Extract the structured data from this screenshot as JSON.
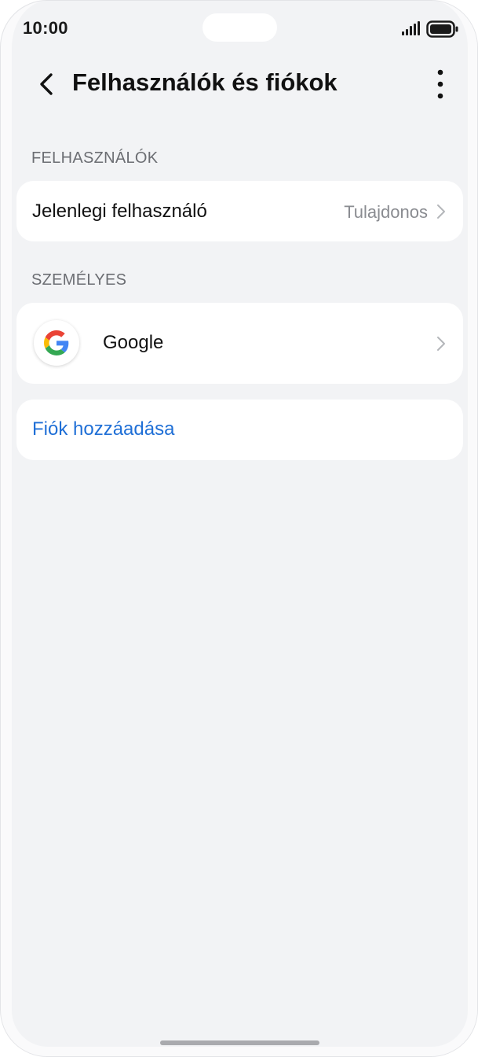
{
  "status_bar": {
    "time": "10:00",
    "icons": [
      "signal-icon",
      "battery-icon"
    ]
  },
  "header": {
    "title": "Felhasználók és fiókok",
    "back_icon": "chevron-left-icon",
    "more_icon": "more-vertical-icon"
  },
  "sections": {
    "users": {
      "label": "FELHASZNÁLÓK",
      "current_user_label": "Jelenlegi felhasználó",
      "current_user_value": "Tulajdonos"
    },
    "personal": {
      "label": "SZEMÉLYES",
      "accounts": [
        {
          "label": "Google",
          "icon": "google-logo-icon"
        }
      ]
    }
  },
  "add_account": {
    "label": "Fiók hozzáadása"
  },
  "colors": {
    "background": "#f2f3f5",
    "card": "#ffffff",
    "accent_link": "#1f6fd6",
    "secondary_text": "#8a8c91"
  }
}
